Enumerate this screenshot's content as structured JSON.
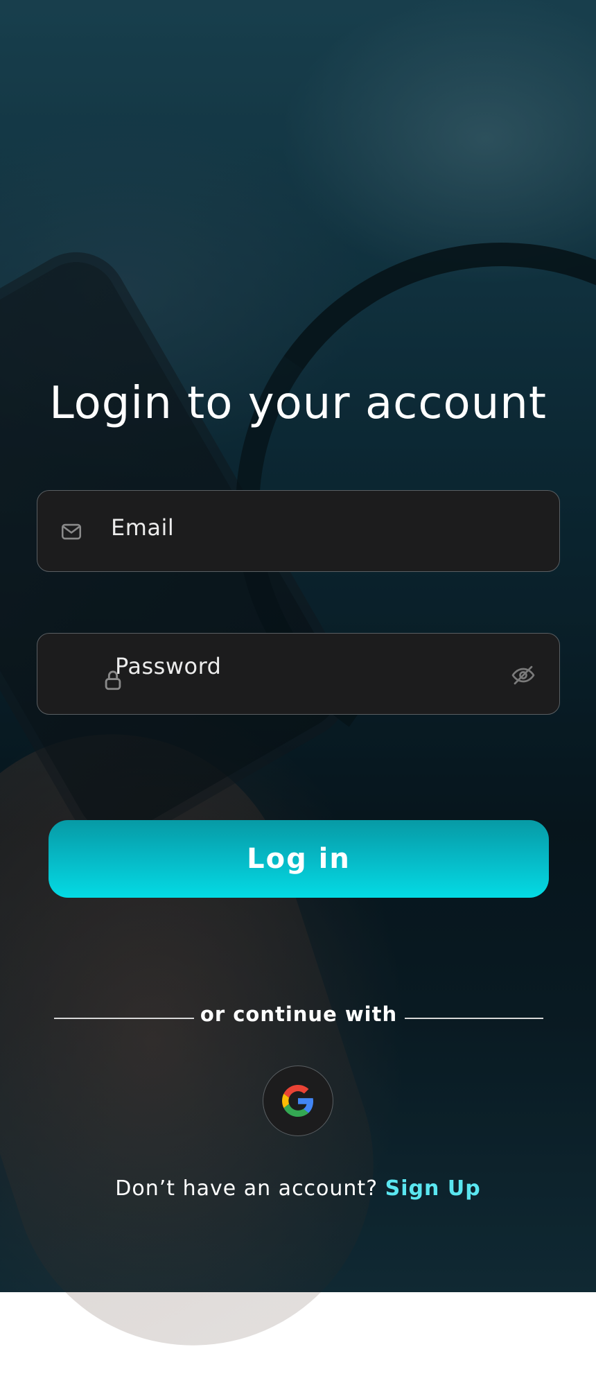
{
  "login": {
    "title": "Login to your account",
    "email_label": "Email",
    "password_label": "Password",
    "login_button": "Log in",
    "divider_text": "or continue with",
    "no_account_text": "Don’t have an account?",
    "signup_link": "Sign Up"
  },
  "icons": {
    "email": "mail-icon",
    "password": "lock-icon",
    "password_toggle": "eye-off-icon",
    "social": "google-icon"
  },
  "colors": {
    "accent": "#04dbe4",
    "link": "#5ae6f0",
    "field_bg": "#1c1c1d"
  }
}
